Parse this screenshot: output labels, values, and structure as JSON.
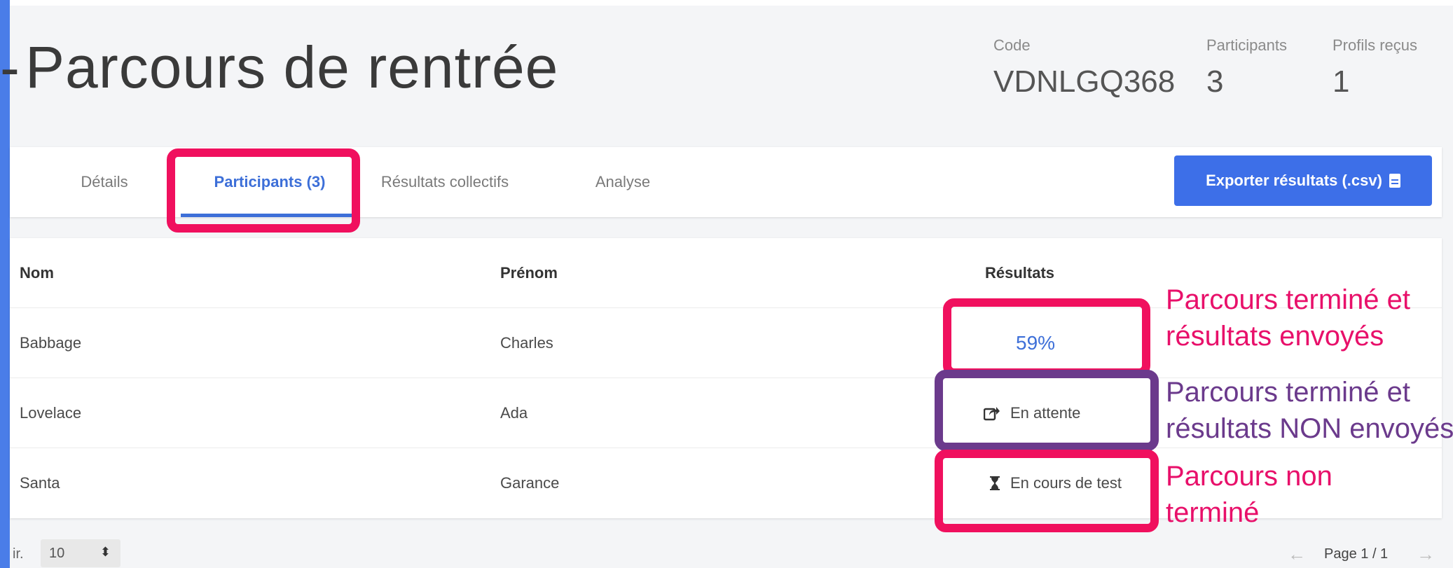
{
  "header": {
    "title": "Parcours de rentrée",
    "stats": [
      {
        "label": "Code",
        "value": "VDNLGQ368"
      },
      {
        "label": "Participants",
        "value": "3"
      },
      {
        "label": "Profils reçus",
        "value": "1"
      }
    ]
  },
  "tabs": [
    {
      "label": "Détails",
      "active": false
    },
    {
      "label": "Participants (3)",
      "active": true
    },
    {
      "label": "Résultats collectifs",
      "active": false
    },
    {
      "label": "Analyse",
      "active": false
    }
  ],
  "export_button": {
    "label": "Exporter résultats (.csv)",
    "icon": "file-icon"
  },
  "table": {
    "columns": [
      "Nom",
      "Prénom",
      "Résultats"
    ],
    "rows": [
      {
        "nom": "Babbage",
        "prenom": "Charles",
        "resultat": "59%",
        "icon": ""
      },
      {
        "nom": "Lovelace",
        "prenom": "Ada",
        "resultat": "En attente",
        "icon": "share-icon"
      },
      {
        "nom": "Santa",
        "prenom": "Garance",
        "resultat": "En cours de test",
        "icon": "hourglass-icon"
      }
    ]
  },
  "annotations": [
    {
      "text": [
        "Parcours terminé et",
        "résultats envoyés"
      ],
      "color": "#e8106a"
    },
    {
      "text": [
        "Parcours terminé et",
        "résultats NON envoyés"
      ],
      "color": "#6b3a8c"
    },
    {
      "text": [
        "Parcours non",
        "terminé"
      ],
      "color": "#e8106a"
    }
  ],
  "footer": {
    "rows_label": "ir.",
    "rows_per_page": "10",
    "page_label": "Page 1 / 1"
  }
}
